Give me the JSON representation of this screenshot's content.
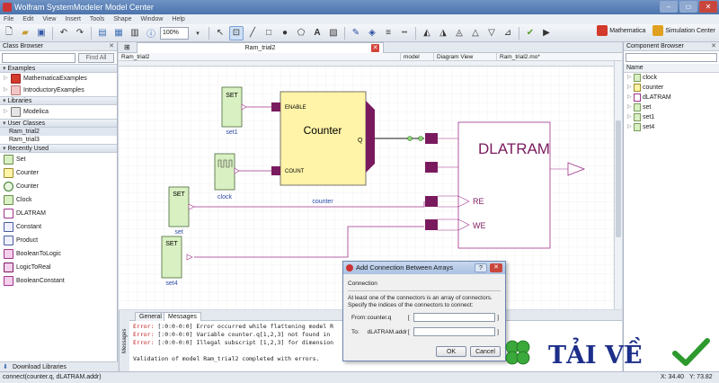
{
  "window": {
    "title": "Wolfram SystemModeler Model Center"
  },
  "menu": [
    "File",
    "Edit",
    "View",
    "Insert",
    "Tools",
    "Shape",
    "Window",
    "Help"
  ],
  "toolbar": {
    "zoom": "100%",
    "mathematica_label": "Mathematica",
    "simulation_label": "Simulation Center"
  },
  "class_browser": {
    "title": "Class Browser",
    "find_all": "Find All",
    "sections": {
      "examples": "Examples",
      "libraries": "Libraries",
      "user_classes": "User Classes",
      "recently_used": "Recently Used"
    },
    "examples": [
      "MathematicaExamples",
      "IntroductoryExamples"
    ],
    "libraries": [
      "Modelica"
    ],
    "user_classes": [
      "Ram_trial2",
      "Ram_trial3"
    ],
    "recent": [
      "Set",
      "Counter",
      "Counter",
      "Clock",
      "DLATRAM",
      "Constant",
      "Product",
      "BooleanToLogic",
      "LogicToReal",
      "BooleanConstant"
    ],
    "download": "Download Libraries"
  },
  "editor": {
    "tab": "Ram_trial2",
    "crumb_left": "Ram_trial2",
    "crumb_model": "model",
    "crumb_view": "Diagram View",
    "crumb_file": "Ram_trial2.mo*"
  },
  "diagram": {
    "set_text": "SET",
    "set1": "set1",
    "set": "set",
    "set4": "set4",
    "clock": "clock",
    "counter_title": "Counter",
    "enable": "ENABLE",
    "count": "COUNT",
    "q": "Q",
    "counter_label": "counter",
    "dlatram": "DLATRAM",
    "re": "RE",
    "we": "WE"
  },
  "messages": {
    "side": "Messages",
    "tab_general": "General",
    "tab_messages": "Messages",
    "lines": [
      {
        "kind": "err",
        "label": "Error:",
        "text": " [:0:0-0:0] Error occurred while flattening model R"
      },
      {
        "kind": "err",
        "label": "Error:",
        "text": " [:0:0-0:0] Variable counter.q[1,2,3] not found in"
      },
      {
        "kind": "err",
        "label": "Error:",
        "text": " [:0:0-0:0] Illegal subscript [1,2,3] for dimension"
      },
      {
        "kind": "blank",
        "label": "",
        "text": ""
      },
      {
        "kind": "info",
        "label": "",
        "text": "Validation of model Ram_trial2 completed with errors."
      }
    ]
  },
  "component_browser": {
    "title": "Component Browser",
    "name_header": "Name",
    "items": [
      "clock",
      "counter",
      "dLATRAM",
      "set",
      "set1",
      "set4"
    ]
  },
  "dialog": {
    "title": "Add Connection Between Arrays",
    "help": "?",
    "group": "Connection",
    "desc1": "At least one of the connectors is an array of connectors.",
    "desc2": "Specify the indices of the connectors to connect:",
    "from_label": "From:",
    "from_name": "counter.q",
    "to_label": "To:",
    "to_name": "dLATRAM.addr",
    "lbr": "[",
    "rbr": "]",
    "ok": "OK",
    "cancel": "Cancel"
  },
  "status": {
    "left": "connect(counter.q, dLATRAM.addr)",
    "x": "X: 34.40",
    "y": "Y: 73.82"
  },
  "watermark": {
    "text": "TẢI VỀ"
  },
  "colors": {
    "block_green": "#d9f0c2",
    "counter_yellow": "#fff4a8",
    "port_purple": "#7a1a5e",
    "dlatram_purple": "#a0338a"
  }
}
